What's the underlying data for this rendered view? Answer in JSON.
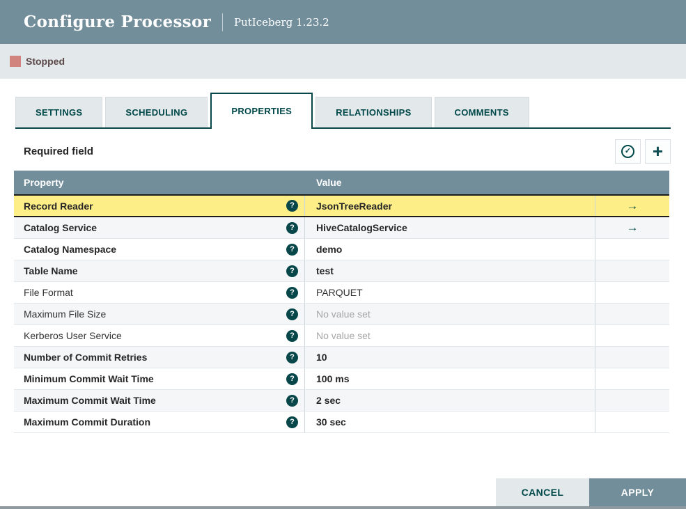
{
  "header": {
    "title": "Configure Processor",
    "subtitle": "PutIceberg 1.23.2"
  },
  "status": {
    "label": "Stopped"
  },
  "tabs": [
    {
      "label": "SETTINGS",
      "active": false
    },
    {
      "label": "SCHEDULING",
      "active": false
    },
    {
      "label": "PROPERTIES",
      "active": true
    },
    {
      "label": "RELATIONSHIPS",
      "active": false
    },
    {
      "label": "COMMENTS",
      "active": false
    }
  ],
  "toolbar": {
    "required_label": "Required field",
    "verify_icon": "check-circle-icon",
    "add_icon": "plus-icon",
    "check_glyph": "✓",
    "plus_glyph": "+"
  },
  "table": {
    "columns": {
      "property": "Property",
      "value": "Value"
    },
    "help_glyph": "?",
    "arrow_glyph": "→",
    "rows": [
      {
        "property": "Record Reader",
        "value": "JsonTreeReader",
        "required": true,
        "highlighted": true,
        "has_arrow": true,
        "unset": false
      },
      {
        "property": "Catalog Service",
        "value": "HiveCatalogService",
        "required": true,
        "highlighted": false,
        "has_arrow": true,
        "unset": false
      },
      {
        "property": "Catalog Namespace",
        "value": "demo",
        "required": true,
        "highlighted": false,
        "has_arrow": false,
        "unset": false
      },
      {
        "property": "Table Name",
        "value": "test",
        "required": true,
        "highlighted": false,
        "has_arrow": false,
        "unset": false
      },
      {
        "property": "File Format",
        "value": "PARQUET",
        "required": false,
        "highlighted": false,
        "has_arrow": false,
        "unset": false
      },
      {
        "property": "Maximum File Size",
        "value": "No value set",
        "required": false,
        "highlighted": false,
        "has_arrow": false,
        "unset": true
      },
      {
        "property": "Kerberos User Service",
        "value": "No value set",
        "required": false,
        "highlighted": false,
        "has_arrow": false,
        "unset": true
      },
      {
        "property": "Number of Commit Retries",
        "value": "10",
        "required": true,
        "highlighted": false,
        "has_arrow": false,
        "unset": false
      },
      {
        "property": "Minimum Commit Wait Time",
        "value": "100 ms",
        "required": true,
        "highlighted": false,
        "has_arrow": false,
        "unset": false
      },
      {
        "property": "Maximum Commit Wait Time",
        "value": "2 sec",
        "required": true,
        "highlighted": false,
        "has_arrow": false,
        "unset": false
      },
      {
        "property": "Maximum Commit Duration",
        "value": "30 sec",
        "required": true,
        "highlighted": false,
        "has_arrow": false,
        "unset": false
      }
    ]
  },
  "footer": {
    "cancel_label": "CANCEL",
    "apply_label": "APPLY"
  },
  "colors": {
    "accent_teal": "#004849",
    "header_slate": "#728e9b",
    "panel_gray": "#e3e8eb",
    "highlight_yellow": "#fdee87",
    "status_stopped": "#d1847e",
    "row_stripe": "#f4f6f7"
  }
}
